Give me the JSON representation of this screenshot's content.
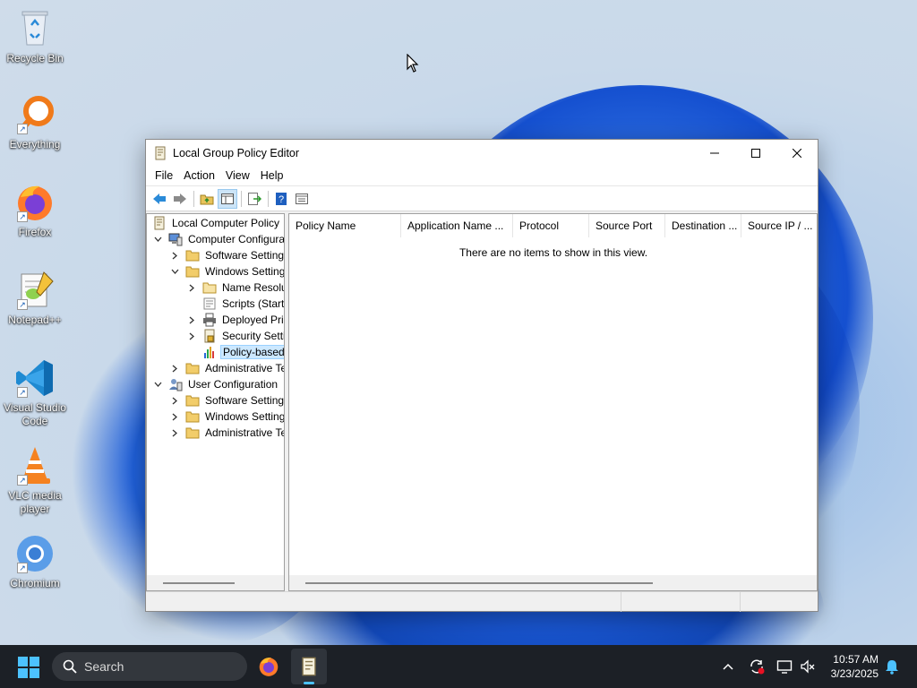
{
  "desktop": {
    "icons": [
      {
        "label": "Recycle Bin",
        "icon": "recycle-bin-icon"
      },
      {
        "label": "Everything",
        "icon": "everything-search-icon"
      },
      {
        "label": "Firefox",
        "icon": "firefox-icon"
      },
      {
        "label": "Notepad++",
        "icon": "notepad-plus-plus-icon"
      },
      {
        "label": "Visual Studio Code",
        "icon": "vscode-icon"
      },
      {
        "label": "VLC media player",
        "icon": "vlc-icon"
      },
      {
        "label": "Chromium",
        "icon": "chromium-icon"
      }
    ]
  },
  "window": {
    "title": "Local Group Policy Editor",
    "menu": [
      "File",
      "Action",
      "View",
      "Help"
    ],
    "toolbar": [
      "back-icon",
      "forward-icon",
      "up-folder-icon",
      "show-hide-tree-icon",
      "export-list-icon",
      "help-icon",
      "properties-icon"
    ],
    "tree": [
      {
        "label": "Local Computer Policy",
        "expander": "none",
        "icon": "policy-doc-icon"
      },
      {
        "label": "Computer Configura",
        "expander": "open",
        "icon": "computer-config-icon"
      },
      {
        "label": "Software Settings",
        "expander": "closed",
        "icon": "folder-icon"
      },
      {
        "label": "Windows Setting",
        "expander": "open",
        "icon": "folder-icon"
      },
      {
        "label": "Name Resolu",
        "expander": "closed",
        "icon": "folder-icon"
      },
      {
        "label": "Scripts (Startu",
        "expander": "none",
        "icon": "scripts-icon"
      },
      {
        "label": "Deployed Prir",
        "expander": "closed",
        "icon": "printer-icon"
      },
      {
        "label": "Security Settir",
        "expander": "closed",
        "icon": "security-icon"
      },
      {
        "label": "Policy-based",
        "expander": "none",
        "icon": "qos-chart-icon",
        "selected": true
      },
      {
        "label": "Administrative Te",
        "expander": "closed",
        "icon": "folder-icon"
      },
      {
        "label": "User Configuration",
        "expander": "open",
        "icon": "user-config-icon"
      },
      {
        "label": "Software Settings",
        "expander": "closed",
        "icon": "folder-icon"
      },
      {
        "label": "Windows Setting",
        "expander": "closed",
        "icon": "folder-icon"
      },
      {
        "label": "Administrative Te",
        "expander": "closed",
        "icon": "folder-icon"
      }
    ],
    "columns": [
      "Policy Name",
      "Application Name ...",
      "Protocol",
      "Source Port",
      "Destination ...",
      "Source IP / ..."
    ],
    "empty_message": "There are no items to show in this view."
  },
  "taskbar": {
    "search_placeholder": "Search",
    "apps": [
      "firefox-icon",
      "group-policy-editor-icon"
    ],
    "time": "10:57 AM",
    "date": "3/23/2025",
    "colors": {
      "accent": "#4cc2ff",
      "background": "#1c2026"
    }
  }
}
